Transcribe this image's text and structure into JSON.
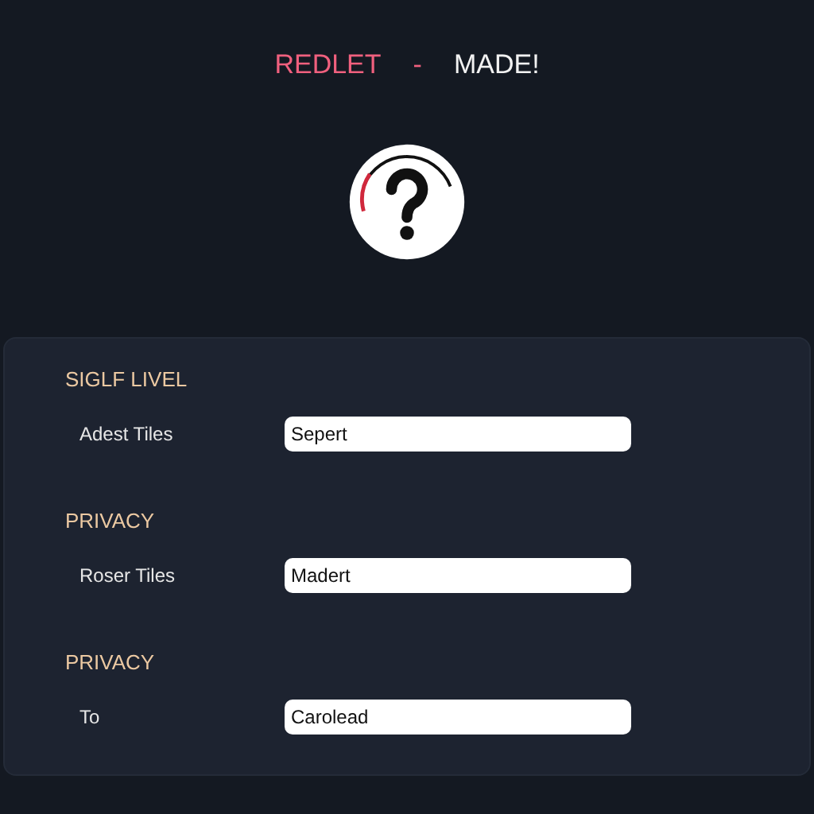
{
  "header": {
    "title_parts": [
      {
        "text": "REDLET",
        "color": "#f0607e"
      },
      {
        "text": "-",
        "color": "#f0607e"
      },
      {
        "text": "MADE!",
        "color": "#f2f2f2"
      }
    ]
  },
  "sections": [
    {
      "heading": "SIGLF LIVEL",
      "rows": [
        {
          "label": "Adest Tiles",
          "value": "Sepert"
        }
      ]
    },
    {
      "heading": "PRIVACY",
      "rows": [
        {
          "label": "Roser Tiles",
          "value": "Madert"
        }
      ]
    },
    {
      "heading": "PRIVACY",
      "rows": [
        {
          "label": "To",
          "value": "Carolead"
        }
      ]
    }
  ]
}
